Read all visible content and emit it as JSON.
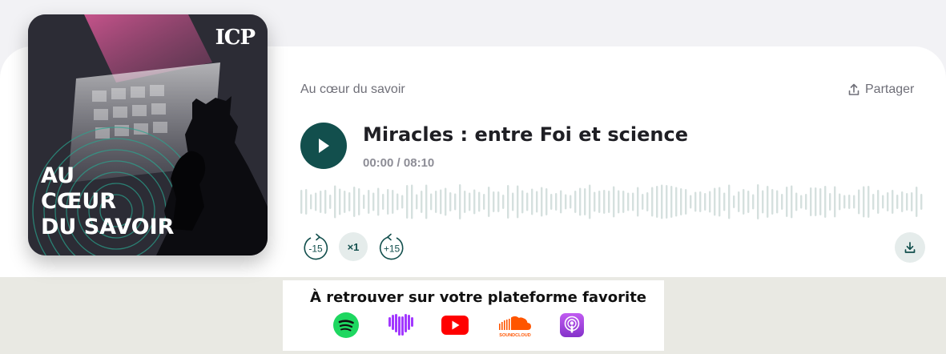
{
  "cover": {
    "brand": "ICP",
    "title_lines": [
      "AU",
      "CŒUR",
      "DU SAVOIR"
    ]
  },
  "header": {
    "show_name": "Au cœur du savoir",
    "share_label": "Partager"
  },
  "episode": {
    "title": "Miracles : entre Foi et science",
    "current_time": "00:00",
    "separator": " / ",
    "duration": "08:10",
    "progress": 0
  },
  "controls": {
    "rewind_label": "-15",
    "speed_label": "×1",
    "forward_label": "+15"
  },
  "platforms": {
    "title": "À retrouver sur votre plateforme favorite",
    "items": [
      {
        "name": "Spotify",
        "icon": "spotify-icon",
        "color": "#1ed760"
      },
      {
        "name": "Deezer",
        "icon": "deezer-heart-icon",
        "color": "#a238ff"
      },
      {
        "name": "YouTube",
        "icon": "youtube-icon",
        "color": "#ff0000"
      },
      {
        "name": "SoundCloud",
        "icon": "soundcloud-icon",
        "color": "#ff5500",
        "caption": "SOUNDCLOUD"
      },
      {
        "name": "Apple Podcasts",
        "icon": "apple-podcasts-icon",
        "color": "#9b3ad9"
      }
    ]
  },
  "colors": {
    "accent": "#124f4d",
    "wave": "#d5e0de",
    "muted_text": "#6f6f78"
  }
}
